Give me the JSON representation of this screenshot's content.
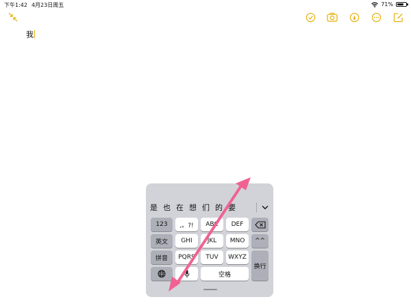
{
  "status_bar": {
    "time": "下午1:42",
    "date": "4月23日周五",
    "battery": "71%",
    "battery_level": 0.71
  },
  "toolbar": {
    "collapse_icon": "arrows-collapse-icon",
    "buttons": [
      "checklist-icon",
      "camera-icon",
      "markup-icon",
      "more-icon",
      "compose-icon"
    ]
  },
  "note": {
    "text": "我"
  },
  "keyboard": {
    "candidates": [
      "是",
      "也",
      "在",
      "想",
      "们",
      "的",
      "要"
    ],
    "keys": {
      "numbers": "123",
      "punct": ",。?!",
      "abc": "ABC",
      "def": "DEF",
      "english": "英文",
      "ghi": "GHI",
      "jkl": "JKL",
      "mno": "MNO",
      "emoticon": "^^",
      "pinyin": "拼音",
      "pqrs": "PQRS",
      "tuv": "TUV",
      "wxyz": "WXYZ",
      "return": "换行",
      "space": "空格"
    }
  },
  "colors": {
    "accent": "#e6ac00",
    "keyboard_bg": "#d2d3d8",
    "arrow": "#f06292"
  }
}
